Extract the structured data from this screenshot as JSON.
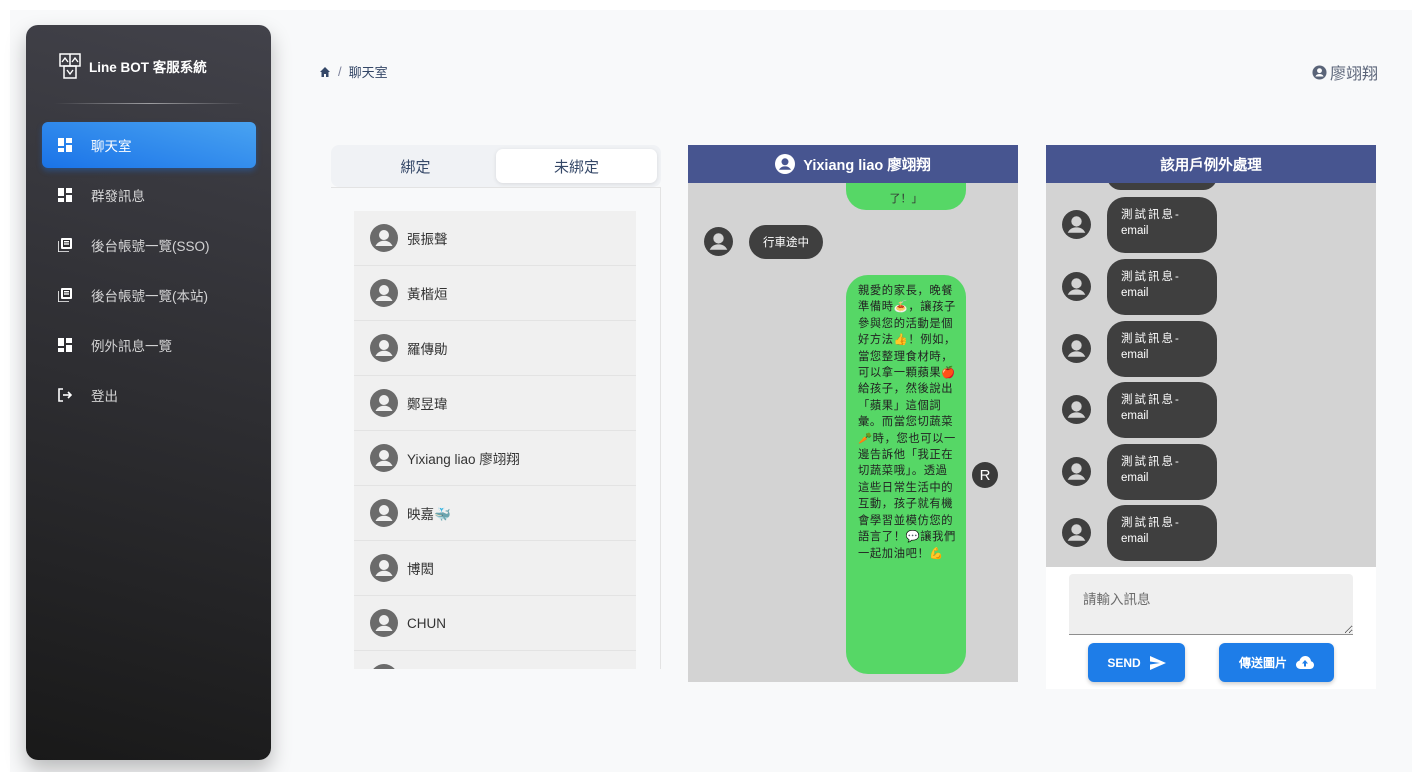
{
  "brand": {
    "title": "Line BOT 客服系統"
  },
  "sidebar": {
    "items": [
      {
        "label": "聊天室",
        "icon": "dashboard-icon",
        "active": true
      },
      {
        "label": "群發訊息",
        "icon": "dashboard-icon",
        "active": false
      },
      {
        "label": "後台帳號一覽(SSO)",
        "icon": "accounts-icon",
        "active": false
      },
      {
        "label": "後台帳號一覽(本站)",
        "icon": "accounts-icon",
        "active": false
      },
      {
        "label": "例外訊息一覽",
        "icon": "dashboard-icon",
        "active": false
      },
      {
        "label": "登出",
        "icon": "logout-icon",
        "active": false
      }
    ]
  },
  "breadcrumb": {
    "current": "聊天室",
    "separator": "/"
  },
  "header": {
    "user_name": "廖翊翔"
  },
  "user_list": {
    "tabs": [
      {
        "label": "綁定"
      },
      {
        "label": "未綁定"
      }
    ],
    "selected_tab": "未綁定",
    "users": [
      {
        "name": "張振聲"
      },
      {
        "name": "黃楷烜"
      },
      {
        "name": "羅傳勛"
      },
      {
        "name": "鄭昱瑋"
      },
      {
        "name": "Yixiang liao 廖翊翔"
      },
      {
        "name": "映嘉🐳"
      },
      {
        "name": "博閎"
      },
      {
        "name": "CHUN"
      }
    ]
  },
  "chat": {
    "header": "Yixiang liao 廖翊翔",
    "top_fragment": "了！」",
    "incoming": "行車途中",
    "outgoing": "親愛的家長，晚餐準備時🍝，讓孩子參與您的活動是個好方法👍！例如，當您整理食材時，可以拿一顆蘋果🍎給孩子，然後說出「蘋果」這個詞彙。而當您切蔬菜🥕時，您也可以一邊告訴他「我正在切蔬菜哦」。透過這些日常生活中的互動，孩子就有機會學習並模仿您的語言了！💬讓我們一起加油吧！💪",
    "sender_badge": "R"
  },
  "exceptions": {
    "header": "該用戶例外處理",
    "messages": [
      {
        "line1": "測試訊息-",
        "line2": "email"
      },
      {
        "line1": "測試訊息-",
        "line2": "email"
      },
      {
        "line1": "測試訊息-",
        "line2": "email"
      },
      {
        "line1": "測試訊息-",
        "line2": "email"
      },
      {
        "line1": "測試訊息-",
        "line2": "email"
      },
      {
        "line1": "測試訊息-",
        "line2": "email"
      }
    ],
    "input_placeholder": "請輸入訊息",
    "send_label": "SEND",
    "image_label": "傳送圖片"
  },
  "colors": {
    "primary": "#1a73e8",
    "chat_header": "#475590",
    "outgoing_bubble": "#56d766",
    "incoming_bubble": "#3f3f3f",
    "chat_background": "#d3d3d3"
  }
}
